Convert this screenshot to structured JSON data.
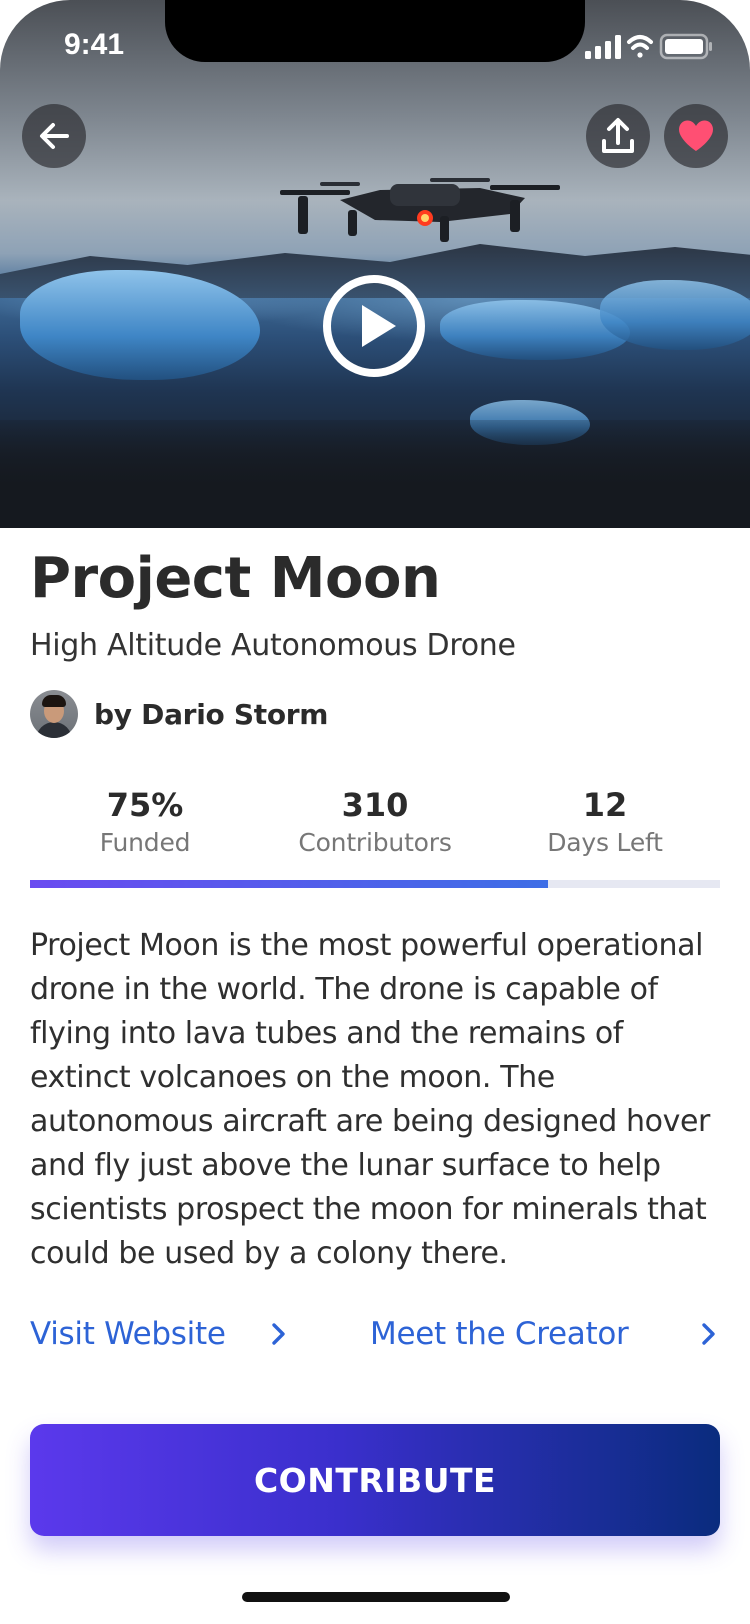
{
  "status_bar": {
    "time": "9:41"
  },
  "hero": {
    "back_icon": "arrow-left-icon",
    "share_icon": "share-upload-icon",
    "favorite_icon": "heart-icon",
    "favorite_color": "#ff4f73",
    "play_icon": "play-circle-icon"
  },
  "project": {
    "title": "Project Moon",
    "subtitle": "High Altitude Autonomous Drone",
    "creator": "by Dario Storm"
  },
  "stats": [
    {
      "value": "75%",
      "label": "Funded"
    },
    {
      "value": "310",
      "label": "Contributors"
    },
    {
      "value": "12",
      "label": "Days Left"
    }
  ],
  "progress": {
    "funded_fraction": 0.75,
    "fill_color": "#5b4ef0",
    "track_color": "#e6e8f2"
  },
  "description": "Project Moon is the most powerful operational drone in the world. The drone is capable of flying into lava tubes and the remains of extinct volcanoes on the moon. The autonomous aircraft are being designed hover and fly just above the lunar surface to help scientists prospect the moon for minerals that could be used by a colony there.",
  "links": {
    "website": "Visit Website",
    "creator": "Meet the Creator",
    "color": "#2d63d6",
    "chevron_icon": "chevron-right-icon"
  },
  "cta": {
    "label": "CONTRIBUTE"
  }
}
